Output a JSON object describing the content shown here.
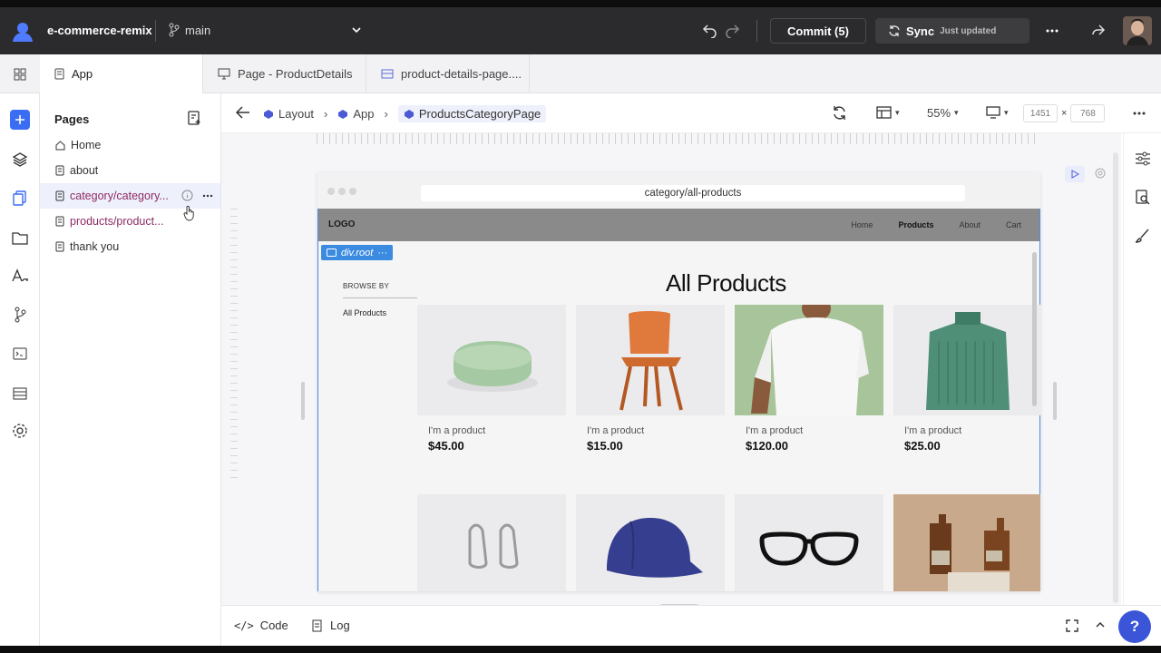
{
  "topbar": {
    "project": "e-commerce-remix",
    "branch": "main",
    "commit_label": "Commit (5)",
    "sync_label": "Sync",
    "sync_status": "Just updated"
  },
  "tabs": [
    {
      "label": "App",
      "icon": "file-icon",
      "active": true
    },
    {
      "label": "Page - ProductDetails",
      "icon": "monitor-icon",
      "active": false
    },
    {
      "label": "product-details-page....",
      "icon": "component-icon",
      "active": false
    }
  ],
  "pages_panel": {
    "title": "Pages",
    "items": [
      {
        "label": "Home",
        "icon": "home-icon"
      },
      {
        "label": "about",
        "icon": "page-icon"
      },
      {
        "label": "category/category...",
        "icon": "page-icon",
        "selected": true
      },
      {
        "label": "products/product...",
        "icon": "page-icon"
      },
      {
        "label": "thank you",
        "icon": "page-icon"
      }
    ]
  },
  "breadcrumb": [
    "Layout",
    "App",
    "ProductsCategoryPage"
  ],
  "canvas_toolbar": {
    "zoom": "55%",
    "width": "1451",
    "times": "×",
    "height": "768"
  },
  "preview": {
    "url": "category/all-products",
    "logo": "LOGO",
    "nav": [
      "Home",
      "Products",
      "About",
      "Cart"
    ],
    "selected_element": "div.root",
    "browse_by": "BROWSE BY",
    "category_link": "All Products",
    "heading": "All Products",
    "products": [
      {
        "name": "I'm a product",
        "price": "$45.00"
      },
      {
        "name": "I'm a product",
        "price": "$15.00"
      },
      {
        "name": "I'm a product",
        "price": "$120.00"
      },
      {
        "name": "I'm a product",
        "price": "$25.00"
      },
      {
        "name": "",
        "price": ""
      },
      {
        "name": "",
        "price": ""
      },
      {
        "name": "",
        "price": ""
      },
      {
        "name": "",
        "price": ""
      }
    ]
  },
  "bottom": {
    "code_label": "Code",
    "log_label": "Log",
    "help": "?"
  },
  "colors": {
    "accent": "#3a55d8",
    "topbar": "#2b2b2d",
    "selection": "#3b8be0"
  }
}
